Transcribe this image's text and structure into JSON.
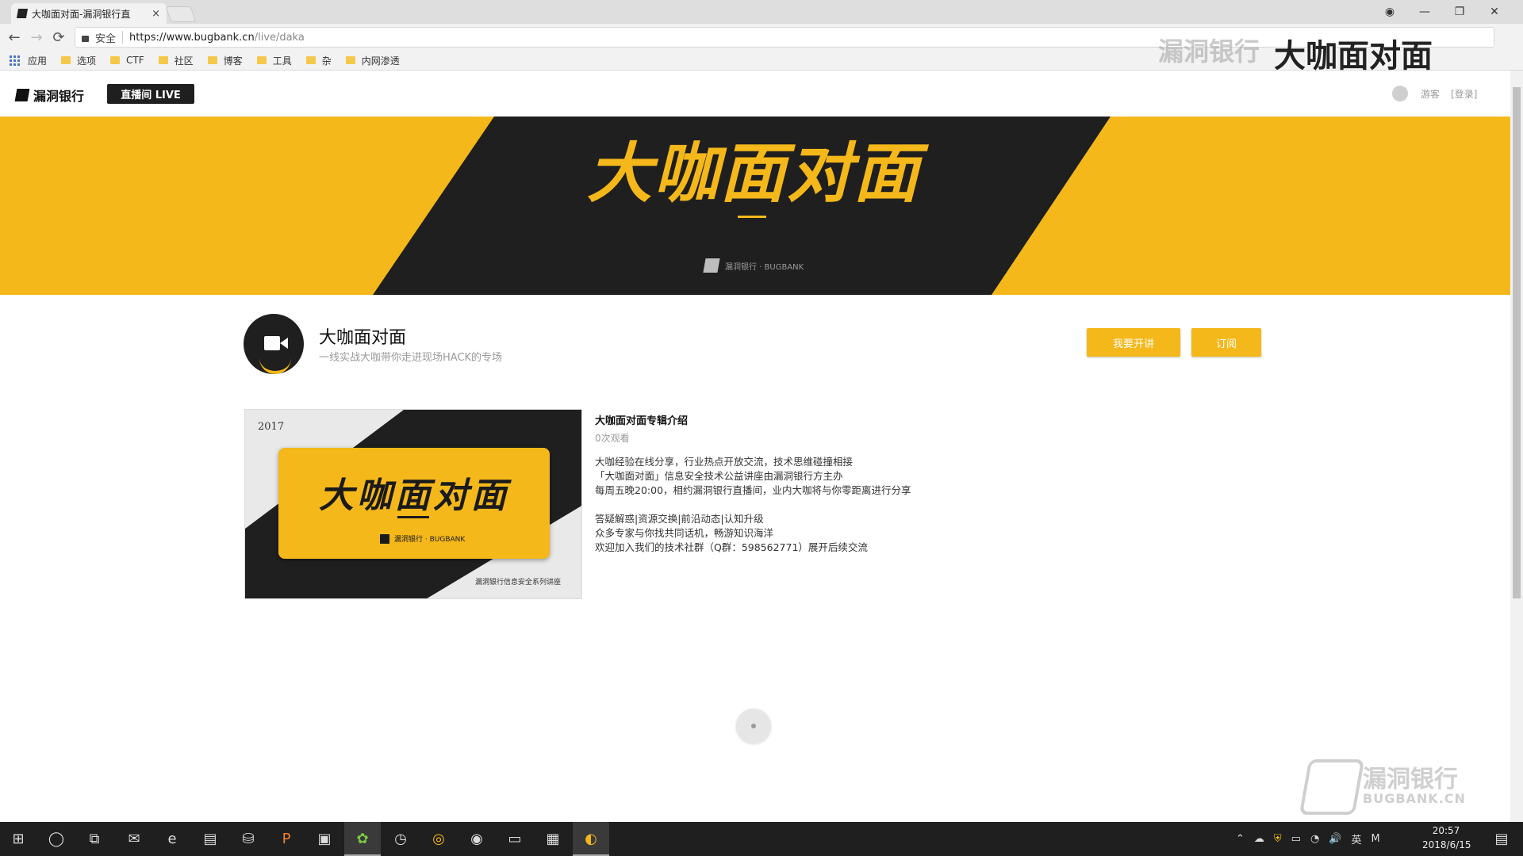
{
  "browser": {
    "tab_title": "大咖面对面-漏洞银行直",
    "tab_close": "×",
    "window_controls": {
      "profile": "◉",
      "minimize": "—",
      "restore": "❐",
      "close": "✕"
    },
    "nav": {
      "back": "←",
      "forward": "→",
      "reload": "⟳"
    },
    "url_secure_label": "安全",
    "url_host": "https://www.bugbank.cn",
    "url_path": "/live/daka",
    "bookmarks": [
      "应用",
      "选项",
      "CTF",
      "社区",
      "博客",
      "工具",
      "杂",
      "内网渗透"
    ]
  },
  "site": {
    "logo_text": "漏洞银行",
    "live_button": "直播间 LIVE",
    "user_guest": "游客",
    "user_login": "[登录]"
  },
  "banner": {
    "title": "大咖面对面",
    "brand_small": "漏洞银行 · BUGBANK"
  },
  "channel": {
    "name": "大咖面对面",
    "description": "一线实战大咖带你走进现场HACK的专场",
    "btn_apply": "我要开讲",
    "btn_subscribe": "订阅"
  },
  "card": {
    "thumb_year": "2017",
    "thumb_title": "大咖面对面",
    "thumb_brand": "漏洞银行 · BUGBANK",
    "thumb_footer": "漏洞银行信息安全系列讲座",
    "intro_title": "大咖面对面专辑介绍",
    "views": "0次观看",
    "body": "大咖经验在线分享，行业热点开放交流，技术思维碰撞相接\n「大咖面对面」信息安全技术公益讲座由漏洞银行方主办\n每周五晚20:00，相约漏洞银行直播间，业内大咖将与你零距离进行分享\n\n答疑解惑|资源交换|前沿动态|认知升级\n众多专家与你找共同话机，畅游知识海洋\n欢迎加入我们的技术社群（Q群：598562771）展开后续交流"
  },
  "watermarks": {
    "top_gray": "漏洞银行",
    "top_dark": "大咖面对面",
    "bottom_cn": "漏洞银行",
    "bottom_en": "BUGBANK.CN"
  },
  "taskbar": {
    "start": "⊞",
    "search": "◯",
    "taskview": "⧉",
    "apps": [
      "✉",
      "e",
      "▤",
      "⛁",
      "P",
      "▣",
      "✿",
      "◷",
      "◎",
      "◉",
      "▭",
      "▦",
      "◐"
    ],
    "tray": [
      "⌃",
      "☁",
      "⛨",
      "▭",
      "◔",
      "🔊",
      "英",
      "M"
    ],
    "time": "20:57",
    "date": "2018/6/15",
    "notification": "▤"
  },
  "colors": {
    "accent": "#f4b81a",
    "dark": "#1f1f1f"
  }
}
